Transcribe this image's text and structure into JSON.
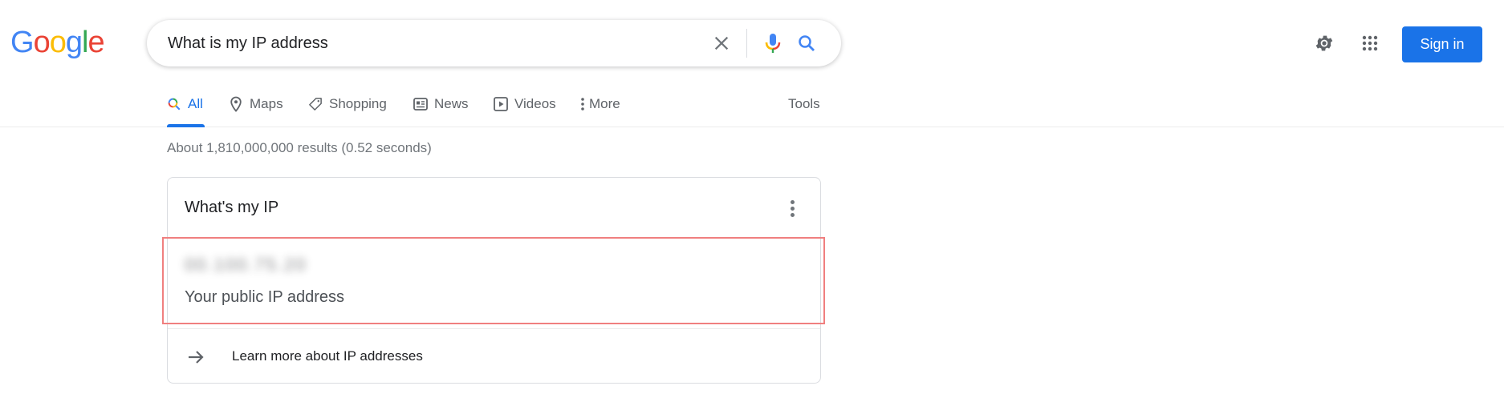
{
  "header": {
    "logo": {
      "letters": [
        "G",
        "o",
        "o",
        "g",
        "l",
        "e"
      ],
      "colors": [
        "#4285f4",
        "#ea4335",
        "#fbbc05",
        "#4285f4",
        "#34a853",
        "#ea4335"
      ]
    },
    "search": {
      "value": "What is my IP address",
      "clear_icon": "close-icon",
      "voice_icon": "microphone-icon",
      "search_icon": "search-icon"
    },
    "settings_icon": "gear-icon",
    "apps_icon": "apps-grid-icon",
    "signin_label": "Sign in"
  },
  "nav": {
    "tabs": [
      {
        "label": "All",
        "icon": "search-icon",
        "active": true
      },
      {
        "label": "Maps",
        "icon": "map-pin-icon",
        "active": false
      },
      {
        "label": "Shopping",
        "icon": "tag-icon",
        "active": false
      },
      {
        "label": "News",
        "icon": "newspaper-icon",
        "active": false
      },
      {
        "label": "Videos",
        "icon": "play-icon",
        "active": false
      },
      {
        "label": "More",
        "icon": "more-vertical-icon",
        "active": false
      }
    ],
    "tools_label": "Tools"
  },
  "results": {
    "stats": "About 1,810,000,000 results (0.52 seconds)"
  },
  "ip_card": {
    "title": "What's my IP",
    "ip_value": "00.100.75.20",
    "ip_value_blurred": true,
    "ip_label": "Your public IP address",
    "learn_more": "Learn more about IP addresses"
  },
  "colors": {
    "accent": "#1a73e8",
    "highlight_border": "#f07f7f",
    "muted_text": "#70757a"
  }
}
